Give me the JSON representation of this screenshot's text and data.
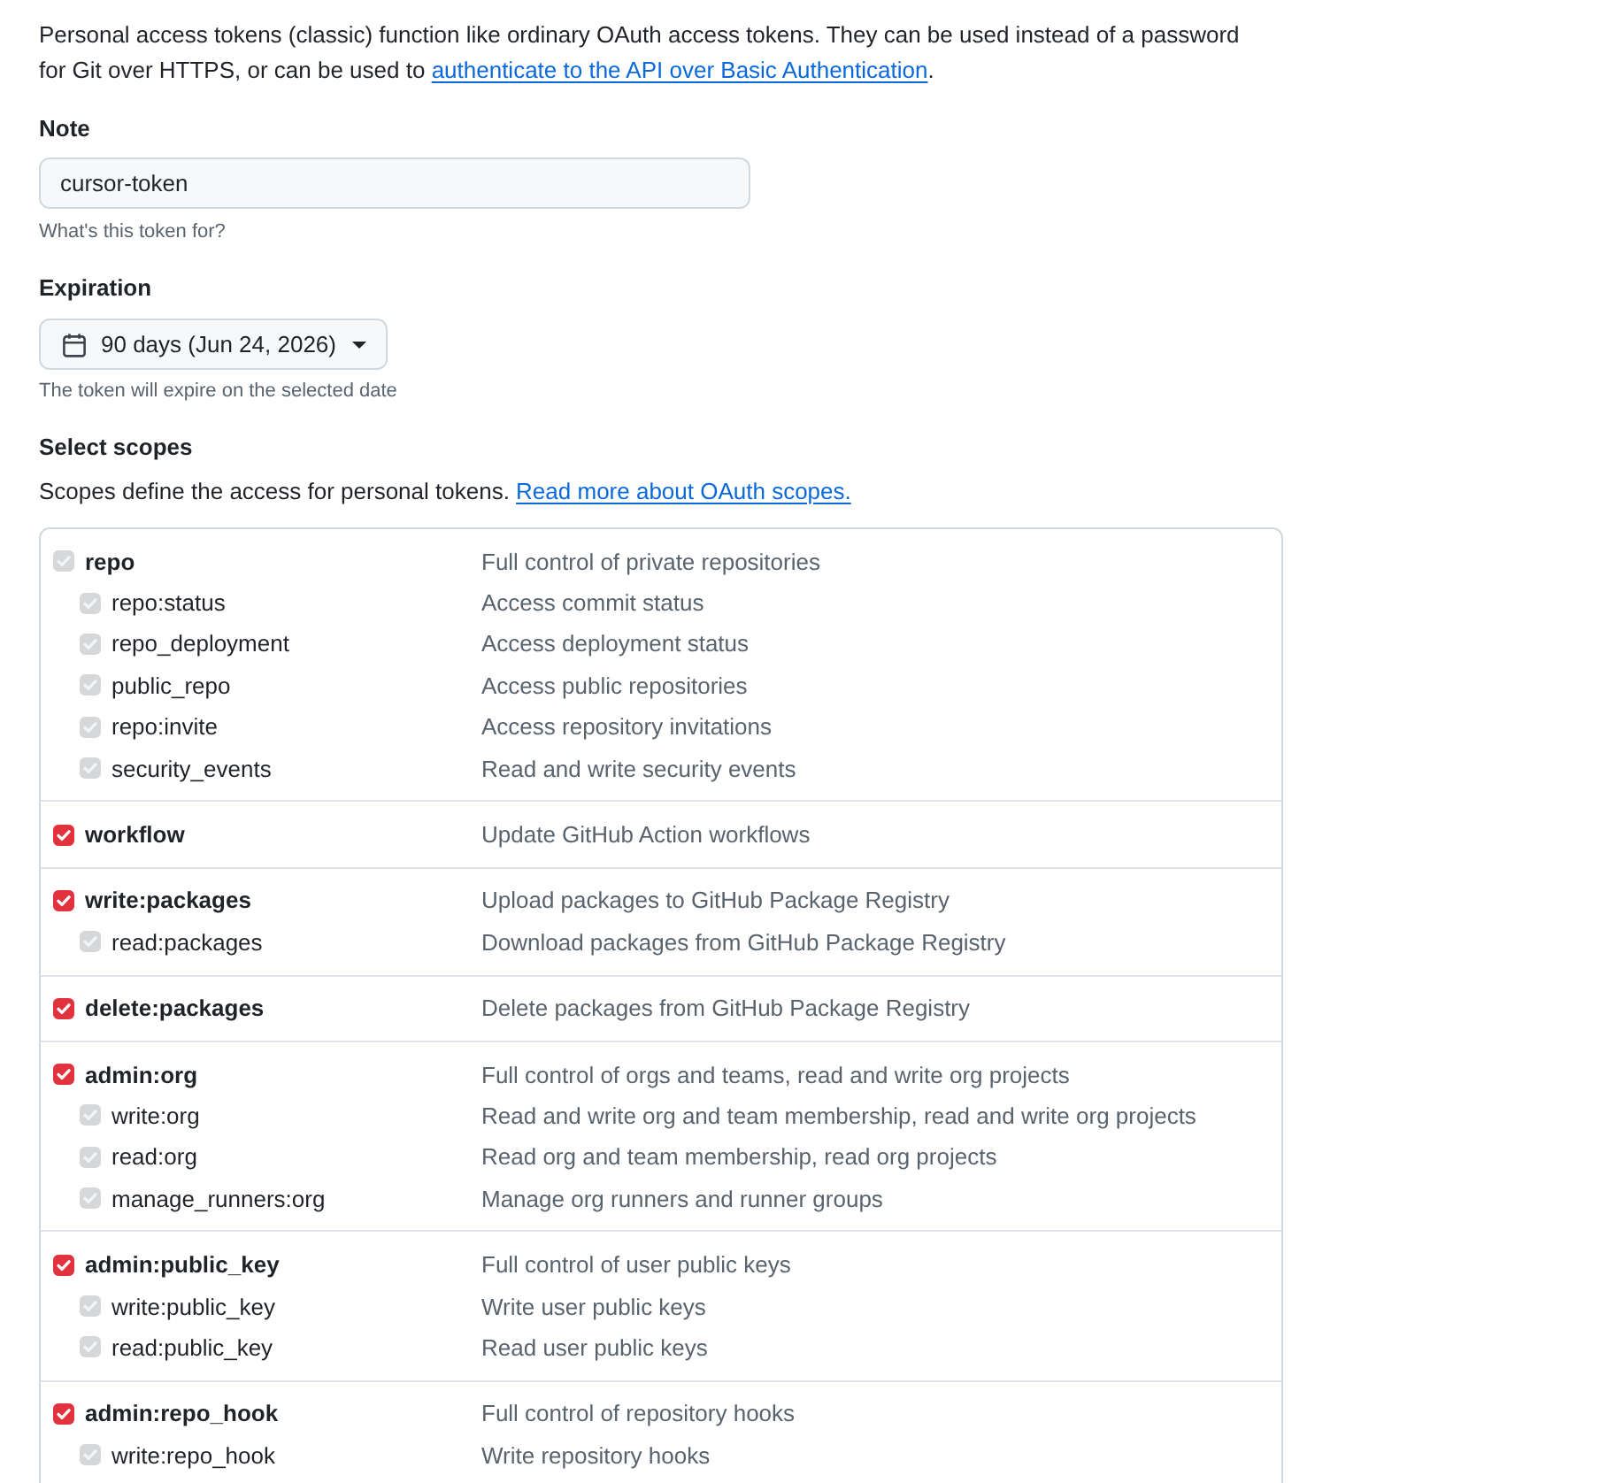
{
  "intro": {
    "text": "Personal access tokens (classic) function like ordinary OAuth access tokens. They can be used instead of a password for Git over HTTPS, or can be used to ",
    "link": "authenticate to the API over Basic Authentication",
    "text_after": "."
  },
  "note": {
    "label": "Note",
    "value": "cursor-token",
    "hint": "What's this token for?"
  },
  "expiration": {
    "label": "Expiration",
    "value": "90 days (Jun 24, 2026)",
    "hint": "The token will expire on the selected date"
  },
  "scopes": {
    "title": "Select scopes",
    "description": "Scopes define the access for personal tokens. ",
    "link": "Read more about OAuth scopes.",
    "groups": [
      {
        "name": "repo",
        "description": "Full control of private repositories",
        "checked": true,
        "disabled": true,
        "children": [
          {
            "name": "repo:status",
            "description": "Access commit status",
            "checked": true,
            "disabled": true
          },
          {
            "name": "repo_deployment",
            "description": "Access deployment status",
            "checked": true,
            "disabled": true
          },
          {
            "name": "public_repo",
            "description": "Access public repositories",
            "checked": true,
            "disabled": true
          },
          {
            "name": "repo:invite",
            "description": "Access repository invitations",
            "checked": true,
            "disabled": true
          },
          {
            "name": "security_events",
            "description": "Read and write security events",
            "checked": true,
            "disabled": true
          }
        ]
      },
      {
        "name": "workflow",
        "description": "Update GitHub Action workflows",
        "checked": true,
        "disabled": false
      },
      {
        "name": "write:packages",
        "description": "Upload packages to GitHub Package Registry",
        "checked": true,
        "disabled": false,
        "children": [
          {
            "name": "read:packages",
            "description": "Download packages from GitHub Package Registry",
            "checked": true,
            "disabled": true
          }
        ]
      },
      {
        "name": "delete:packages",
        "description": "Delete packages from GitHub Package Registry",
        "checked": true,
        "disabled": false
      },
      {
        "name": "admin:org",
        "description": "Full control of orgs and teams, read and write org projects",
        "checked": true,
        "disabled": false,
        "children": [
          {
            "name": "write:org",
            "description": "Read and write org and team membership, read and write org projects",
            "checked": true,
            "disabled": true
          },
          {
            "name": "read:org",
            "description": "Read org and team membership, read org projects",
            "checked": true,
            "disabled": true
          },
          {
            "name": "manage_runners:org",
            "description": "Manage org runners and runner groups",
            "checked": true,
            "disabled": true
          }
        ]
      },
      {
        "name": "admin:public_key",
        "description": "Full control of user public keys",
        "checked": true,
        "disabled": false,
        "children": [
          {
            "name": "write:public_key",
            "description": "Write user public keys",
            "checked": true,
            "disabled": true
          },
          {
            "name": "read:public_key",
            "description": "Read user public keys",
            "checked": true,
            "disabled": true
          }
        ]
      },
      {
        "name": "admin:repo_hook",
        "description": "Full control of repository hooks",
        "checked": true,
        "disabled": false,
        "children": [
          {
            "name": "write:repo_hook",
            "description": "Write repository hooks",
            "checked": true,
            "disabled": true
          }
        ]
      }
    ]
  }
}
